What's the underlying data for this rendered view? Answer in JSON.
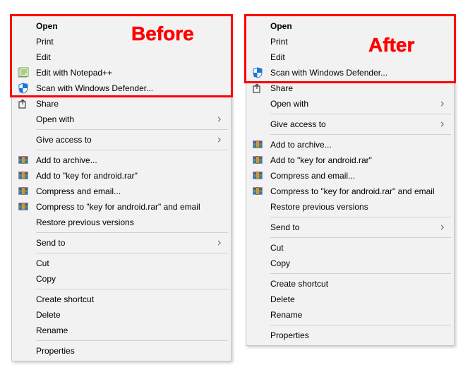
{
  "captions": {
    "before": "Before",
    "after": "After"
  },
  "left": {
    "items": [
      {
        "label": "Open",
        "bold": true
      },
      {
        "label": "Print"
      },
      {
        "label": "Edit"
      },
      {
        "label": "Edit with Notepad++",
        "icon": "notepadpp"
      },
      {
        "label": "Scan with Windows Defender...",
        "icon": "defender"
      },
      {
        "label": "Share",
        "icon": "share"
      },
      {
        "label": "Open with",
        "submenu": true
      },
      {
        "sep": true
      },
      {
        "label": "Give access to",
        "submenu": true
      },
      {
        "sep": true
      },
      {
        "label": "Add to archive...",
        "icon": "winrar"
      },
      {
        "label": "Add to \"key for android.rar\"",
        "icon": "winrar"
      },
      {
        "label": "Compress and email...",
        "icon": "winrar"
      },
      {
        "label": "Compress to \"key for android.rar\" and email",
        "icon": "winrar"
      },
      {
        "label": "Restore previous versions"
      },
      {
        "sep": true
      },
      {
        "label": "Send to",
        "submenu": true
      },
      {
        "sep": true
      },
      {
        "label": "Cut"
      },
      {
        "label": "Copy"
      },
      {
        "sep": true
      },
      {
        "label": "Create shortcut"
      },
      {
        "label": "Delete"
      },
      {
        "label": "Rename"
      },
      {
        "sep": true
      },
      {
        "label": "Properties"
      }
    ]
  },
  "right": {
    "items": [
      {
        "label": "Open",
        "bold": true
      },
      {
        "label": "Print"
      },
      {
        "label": "Edit"
      },
      {
        "label": "Scan with Windows Defender...",
        "icon": "defender"
      },
      {
        "label": "Share",
        "icon": "share"
      },
      {
        "label": "Open with",
        "submenu": true
      },
      {
        "sep": true
      },
      {
        "label": "Give access to",
        "submenu": true
      },
      {
        "sep": true
      },
      {
        "label": "Add to archive...",
        "icon": "winrar"
      },
      {
        "label": "Add to \"key for android.rar\"",
        "icon": "winrar"
      },
      {
        "label": "Compress and email...",
        "icon": "winrar"
      },
      {
        "label": "Compress to \"key for android.rar\" and email",
        "icon": "winrar"
      },
      {
        "label": "Restore previous versions"
      },
      {
        "sep": true
      },
      {
        "label": "Send to",
        "submenu": true
      },
      {
        "sep": true
      },
      {
        "label": "Cut"
      },
      {
        "label": "Copy"
      },
      {
        "sep": true
      },
      {
        "label": "Create shortcut"
      },
      {
        "label": "Delete"
      },
      {
        "label": "Rename"
      },
      {
        "sep": true
      },
      {
        "label": "Properties"
      }
    ]
  }
}
